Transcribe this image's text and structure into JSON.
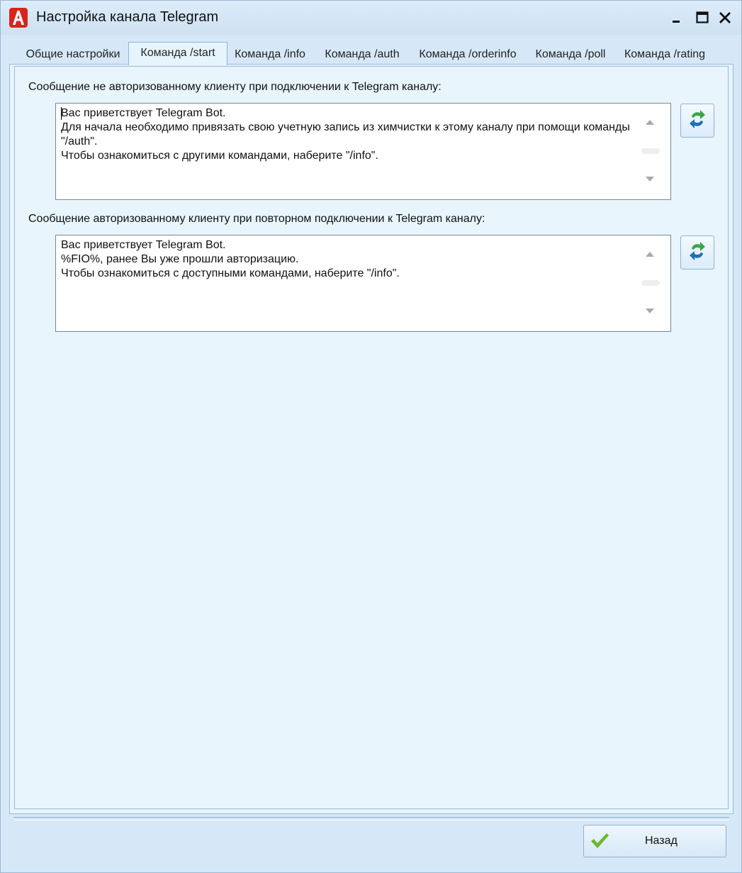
{
  "window": {
    "title": "Настройка канала Telegram",
    "icon": "app-logo-icon",
    "controls": [
      "minimize-icon",
      "maximize-icon",
      "close-icon"
    ]
  },
  "tabs": [
    {
      "label": "Общие настройки",
      "active": false
    },
    {
      "label": "Команда /start",
      "active": true
    },
    {
      "label": "Команда /info",
      "active": false
    },
    {
      "label": "Команда /auth",
      "active": false
    },
    {
      "label": "Команда /orderinfo",
      "active": false
    },
    {
      "label": "Команда /poll",
      "active": false
    },
    {
      "label": "Команда /rating",
      "active": false
    }
  ],
  "sections": [
    {
      "label": "Сообщение не авторизованному клиенту при подключении к Telegram каналу:",
      "message": "Вас приветствует Telegram Bot.\nДля начала необходимо привязать свою учетную запись из химчистки к этому каналу при помощи команды \"/auth\".\nЧтобы ознакомиться с другими командами, наберите \"/info\".",
      "refresh_icon": "refresh-icon"
    },
    {
      "label": "Сообщение авторизованному клиенту при повторном подключении к Telegram каналу:",
      "message": "Вас приветствует Telegram Bot.\n%FIO%, ранее Вы уже прошли авторизацию.\nЧтобы ознакомиться с доступными командами, наберите \"/info\".",
      "refresh_icon": "refresh-icon"
    }
  ],
  "footer": {
    "back_label": "Назад",
    "back_icon": "checkmark-icon"
  },
  "colors": {
    "window_bg": "#d6e8f7",
    "panel_bg": "#e8f5fd",
    "border": "#9bbad6",
    "check_green": "#6ab82f"
  }
}
